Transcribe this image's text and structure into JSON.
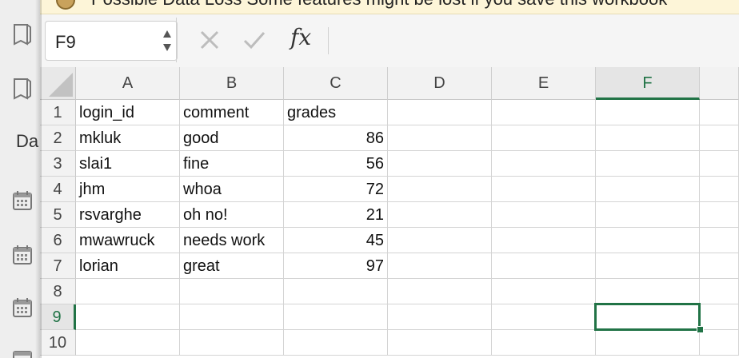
{
  "banner": {
    "text": "Possible Data Loss  Some features might be lost if you save this workbook"
  },
  "sidebar": {
    "partial_label": "Da",
    "icons": [
      "file-icon",
      "file-icon",
      "calendar-icon",
      "calendar-icon",
      "calendar-icon",
      "calendar-icon"
    ]
  },
  "formula_bar": {
    "name_box": "F9",
    "cancel_icon": "x-icon",
    "confirm_icon": "check-icon",
    "fx_label": "fx",
    "formula_value": ""
  },
  "sheet": {
    "columns": [
      "A",
      "B",
      "C",
      "D",
      "E",
      "F"
    ],
    "active_column": "F",
    "rows": [
      "1",
      "2",
      "3",
      "4",
      "5",
      "6",
      "7",
      "8",
      "9",
      "10"
    ],
    "active_row": "9",
    "selected_cell": "F9",
    "cells": [
      [
        "login_id",
        "comment",
        "grades",
        "",
        "",
        ""
      ],
      [
        "mkluk",
        "good",
        "86",
        "",
        "",
        ""
      ],
      [
        "slai1",
        "fine",
        "56",
        "",
        "",
        ""
      ],
      [
        "jhm",
        "whoa",
        "72",
        "",
        "",
        ""
      ],
      [
        "rsvarghe",
        "oh no!",
        "21",
        "",
        "",
        ""
      ],
      [
        "mwawruck",
        "needs work",
        "45",
        "",
        "",
        ""
      ],
      [
        "lorian",
        "great",
        "97",
        "",
        "",
        ""
      ],
      [
        "",
        "",
        "",
        "",
        "",
        ""
      ],
      [
        "",
        "",
        "",
        "",
        "",
        ""
      ],
      [
        "",
        "",
        "",
        "",
        "",
        ""
      ]
    ],
    "numeric_columns": [
      "C"
    ]
  },
  "colors": {
    "accent": "#217346",
    "header_bg": "#f2f2f2",
    "banner_bg": "#fdf5d8"
  }
}
